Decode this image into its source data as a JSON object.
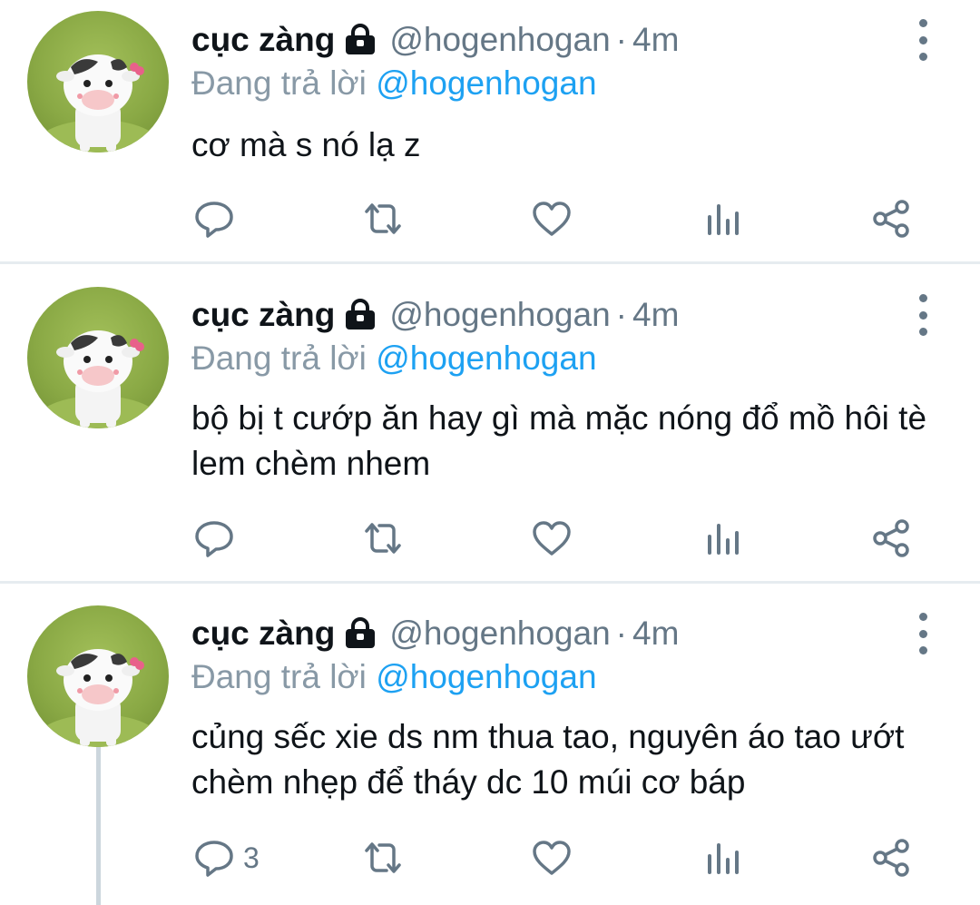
{
  "tweets": [
    {
      "name": "cục zàng",
      "handle": "@hogenhogan",
      "separator": "·",
      "time": "4m",
      "reply_prefix": "Đang trả lời",
      "reply_to": "@hogenhogan",
      "text": "cơ mà s nó lạ z",
      "reply_count": ""
    },
    {
      "name": "cục zàng",
      "handle": "@hogenhogan",
      "separator": "·",
      "time": "4m",
      "reply_prefix": "Đang trả lời",
      "reply_to": "@hogenhogan",
      "text": "bộ bị t cướp ăn hay gì mà mặc nóng đổ mồ hôi tè lem chèm nhem",
      "reply_count": ""
    },
    {
      "name": "cục zàng",
      "handle": "@hogenhogan",
      "separator": "·",
      "time": "4m",
      "reply_prefix": "Đang trả lời",
      "reply_to": "@hogenhogan",
      "text": "củng sếc xie ds nm thua tao, nguyên áo tao ướt chèm nhẹp để tháy dc 10 múi cơ báp",
      "reply_count": "3"
    }
  ],
  "icons": {
    "lock": "lock-icon",
    "more": "more-vertical-icon",
    "reply": "comment-icon",
    "retweet": "retweet-icon",
    "like": "heart-icon",
    "analytics": "analytics-icon",
    "share": "share-icon"
  },
  "colors": {
    "link": "#1da1f2",
    "secondary": "#657786",
    "divider": "#e6ecf0"
  }
}
